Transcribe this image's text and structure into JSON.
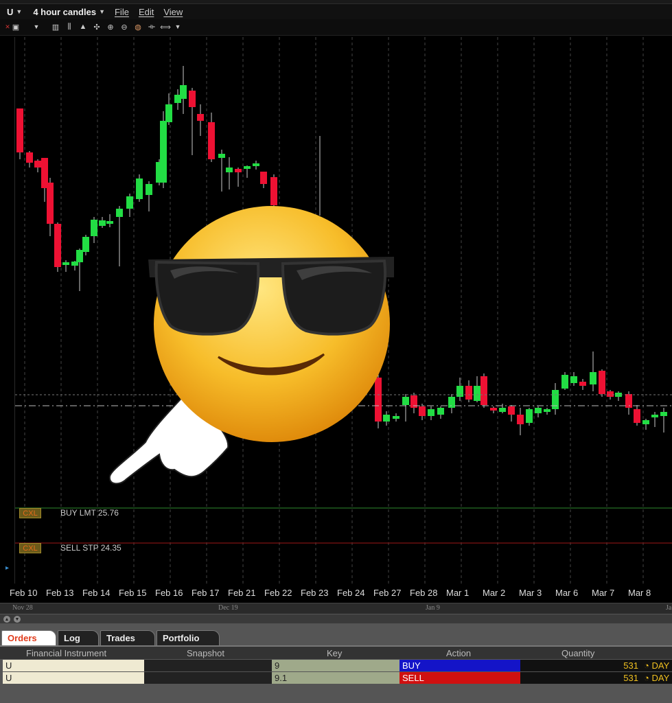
{
  "menubar": {
    "symbol": "U",
    "bar_size": "4 hour candles",
    "menus": [
      "File",
      "Edit",
      "View"
    ]
  },
  "chart": {
    "order_lines": [
      {
        "cxl_label": "CXL",
        "text": "BUY LMT 25.76",
        "color": "#2e8b2e"
      },
      {
        "cxl_label": "CXL",
        "text": "SELL STP 24.35",
        "color": "#a01818"
      }
    ],
    "colors": {
      "up": "#22dd44",
      "down": "#ee1133",
      "grid": "#444444",
      "wick": "#cccccc"
    },
    "x_labels": [
      "Feb 10",
      "Feb 13",
      "Feb 14",
      "Feb 15",
      "Feb 16",
      "Feb 17",
      "Feb 21",
      "Feb 22",
      "Feb 23",
      "Feb 24",
      "Feb 27",
      "Feb 28",
      "Mar 1",
      "Mar 2",
      "Mar 3",
      "Mar 6",
      "Mar 7",
      "Mar 8"
    ],
    "overlay_emoji": "😎"
  },
  "navigator": {
    "labels": [
      "Nov 28",
      "Dec 19",
      "Jan 9",
      "Ja"
    ]
  },
  "panel": {
    "tabs": [
      "Orders",
      "Log",
      "Trades",
      "Portfolio"
    ],
    "columns": [
      "Financial Instrument",
      "Snapshot",
      "Key",
      "Action",
      "Quantity"
    ],
    "rows": [
      {
        "instrument": "U",
        "snapshot": "",
        "key": "9",
        "action": "BUY",
        "action_color": "#1414c8",
        "quantity": "531",
        "tif": "DAY"
      },
      {
        "instrument": "U",
        "snapshot": "",
        "key": "9.1",
        "action": "SELL",
        "action_color": "#d01010",
        "quantity": "531",
        "tif": "DAY"
      }
    ]
  }
}
